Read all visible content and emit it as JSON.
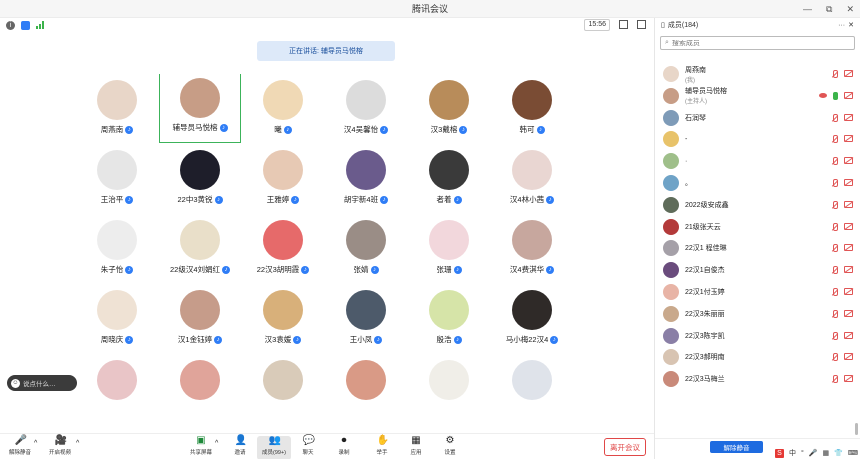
{
  "window": {
    "title": "腾讯会议",
    "controls": [
      "—",
      "⧉",
      "✕"
    ]
  },
  "meeting": {
    "time": "15:56",
    "speaking_banner": "正在讲话: 辅导员马悦榕",
    "chat_placeholder": "说点什么…",
    "participants": [
      {
        "name": "周燕南",
        "color": "#e8d6c8"
      },
      {
        "name": "辅导员马悦榕",
        "color": "#c79d86",
        "active": true
      },
      {
        "name": "曦",
        "color": "#f0d9b5"
      },
      {
        "name": "汉4吴馨怡",
        "color": "#dcdcdc"
      },
      {
        "name": "汉3戴榕",
        "color": "#b88c5a"
      },
      {
        "name": "韩可",
        "color": "#7a4c34"
      },
      {
        "name": "王治平",
        "color": "#e6e6e6"
      },
      {
        "name": "22中3黄锐",
        "color": "#1e1e2a"
      },
      {
        "name": "王雅婷",
        "color": "#e7c9b4"
      },
      {
        "name": "胡宇新4班",
        "color": "#6a5b8c"
      },
      {
        "name": "者着",
        "color": "#3a3a3a"
      },
      {
        "name": "汉4林小茜",
        "color": "#e9d6d2"
      },
      {
        "name": "朱子怡",
        "color": "#ededed"
      },
      {
        "name": "22级汉4刘娟红",
        "color": "#e9dfc9"
      },
      {
        "name": "22汉3胡明霞",
        "color": "#e66a6a"
      },
      {
        "name": "张婧",
        "color": "#9a8d86"
      },
      {
        "name": "张珊",
        "color": "#f2d7dc"
      },
      {
        "name": "汉4费淇华",
        "color": "#c7a79e"
      },
      {
        "name": "周晓庆",
        "color": "#efe2d4"
      },
      {
        "name": "汉1金钰婷",
        "color": "#c69c8a"
      },
      {
        "name": "汉3袁媛",
        "color": "#d8b07a"
      },
      {
        "name": "王小凤",
        "color": "#4d5a6a"
      },
      {
        "name": "殷浩",
        "color": "#d6e4a8"
      },
      {
        "name": "马小梅22汉4",
        "color": "#2f2a28"
      },
      {
        "name": "",
        "color": "#e9c5c7"
      },
      {
        "name": "",
        "color": "#e0a49a"
      },
      {
        "name": "",
        "color": "#d9cbb9"
      },
      {
        "name": "",
        "color": "#d99a86"
      },
      {
        "name": "",
        "color": "#f0eee8"
      },
      {
        "name": "",
        "color": "#dfe3ea"
      }
    ]
  },
  "toolbar": {
    "left": [
      {
        "icon": "🎤",
        "label": "解除静音"
      },
      {
        "icon": "🎥",
        "label": "开启视频"
      }
    ],
    "center": [
      {
        "icon": "▣",
        "label": "共享屏幕"
      },
      {
        "icon": "👤",
        "label": "邀请"
      },
      {
        "icon": "👥",
        "label": "成员(99+)",
        "selected": true
      },
      {
        "icon": "💬",
        "label": "聊天"
      },
      {
        "icon": "⏺",
        "label": "录制"
      },
      {
        "icon": "✋",
        "label": "举手"
      },
      {
        "icon": "▦",
        "label": "应用"
      },
      {
        "icon": "⚙",
        "label": "设置"
      }
    ],
    "leave_label": "离开会议"
  },
  "panel": {
    "title": "成员(184)",
    "more": "···",
    "close": "✕",
    "search_placeholder": "搜索成员",
    "members": [
      {
        "name": "周燕南",
        "role": "(我)",
        "color": "#e8d6c8"
      },
      {
        "name": "辅导员马悦榕",
        "role": "(主持人)",
        "color": "#c79d86",
        "speaking": true
      },
      {
        "name": "石润琴",
        "role": "",
        "color": "#7e9bb8"
      },
      {
        "name": "-",
        "role": "",
        "color": "#e8c36a"
      },
      {
        "name": "·",
        "role": "",
        "color": "#9fbf8a"
      },
      {
        "name": "。",
        "role": "",
        "color": "#6fa3c7"
      },
      {
        "name": "2022级安成鑫",
        "role": "",
        "color": "#5f6c5a"
      },
      {
        "name": "21级张天云",
        "role": "",
        "color": "#b33a3a"
      },
      {
        "name": "22汉1 程佳琳",
        "role": "",
        "color": "#a5a0a8"
      },
      {
        "name": "22汉1自俊杰",
        "role": "",
        "color": "#6a4c7d"
      },
      {
        "name": "22汉1付玉婷",
        "role": "",
        "color": "#e8b4a6"
      },
      {
        "name": "22汉3朱丽丽",
        "role": "",
        "color": "#c9a98c"
      },
      {
        "name": "22汉3陈宇凯",
        "role": "",
        "color": "#8a7fa6"
      },
      {
        "name": "22汉3郝明南",
        "role": "",
        "color": "#d8c4b2"
      },
      {
        "name": "22汉3马梅兰",
        "role": "",
        "color": "#c98a7a"
      }
    ],
    "unmute_all_label": "解除静音",
    "ime": [
      "S",
      "中",
      "°",
      "🎤",
      "▦",
      "👕",
      "⌨"
    ]
  }
}
